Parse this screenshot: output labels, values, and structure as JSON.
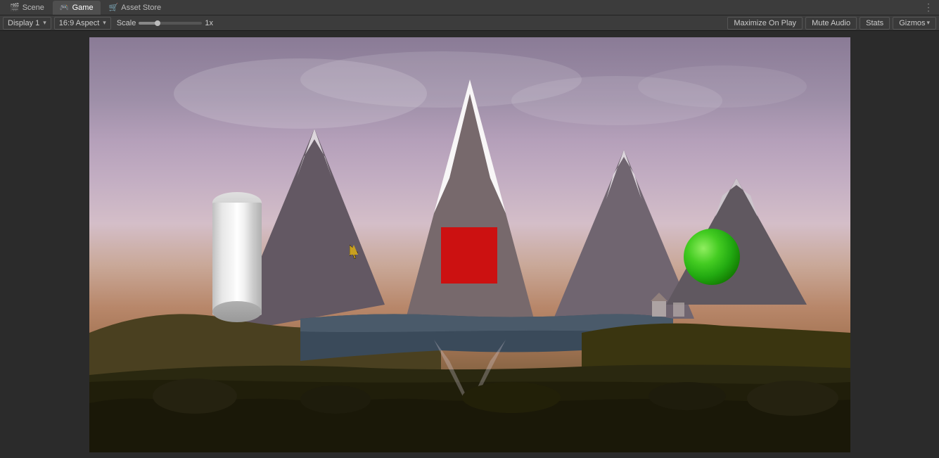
{
  "tabs": [
    {
      "id": "scene",
      "label": "Scene",
      "icon": "🎬",
      "active": false
    },
    {
      "id": "game",
      "label": "Game",
      "icon": "🎮",
      "active": true
    },
    {
      "id": "asset-store",
      "label": "Asset Store",
      "icon": "🛒",
      "active": false
    }
  ],
  "toolbar": {
    "display_label": "Display 1",
    "aspect_label": "16:9 Aspect",
    "scale_label": "Scale",
    "scale_value": "1x",
    "maximize_label": "Maximize On Play",
    "mute_label": "Mute Audio",
    "stats_label": "Stats",
    "gizmos_label": "Gizmos"
  },
  "viewport": {
    "objects": [
      {
        "type": "cylinder",
        "label": "Cylinder"
      },
      {
        "type": "cube",
        "label": "Red Cube"
      },
      {
        "type": "sphere",
        "label": "Green Sphere"
      }
    ]
  }
}
